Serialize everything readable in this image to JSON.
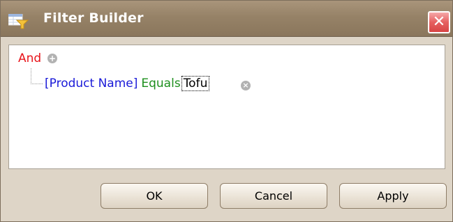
{
  "window": {
    "title": "Filter Builder",
    "close_glyph": "✕"
  },
  "filter": {
    "group_operator": "And",
    "add_glyph": "+",
    "condition": {
      "field": "[Product Name]",
      "operator": "Equals",
      "value": "Tofu",
      "remove_glyph": "×"
    }
  },
  "buttons": {
    "ok": "OK",
    "cancel": "Cancel",
    "apply": "Apply"
  },
  "colors": {
    "group_operator": "#e8141b",
    "field": "#1a1ad8",
    "operator": "#1d8f1d",
    "titlebar": "#968267",
    "close": "#e66060"
  }
}
